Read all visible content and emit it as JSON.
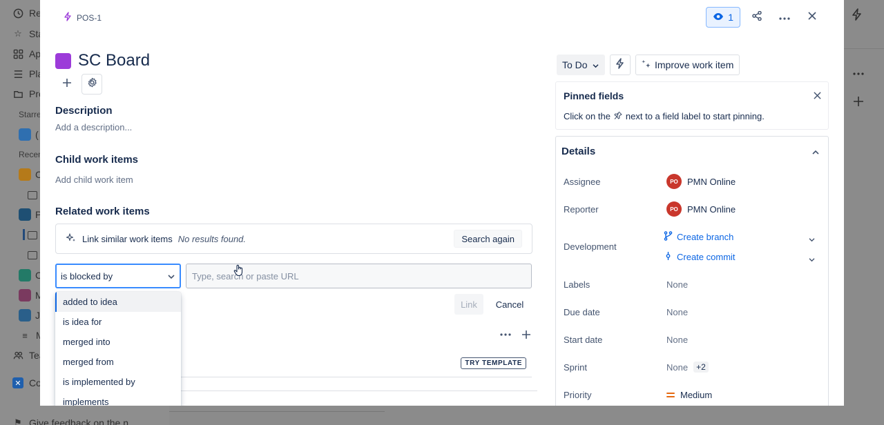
{
  "background": {
    "sidebar_items": [
      {
        "label": "Rec",
        "icon": "clock-icon"
      },
      {
        "label": "Sta",
        "icon": "star-icon"
      },
      {
        "label": "Ap",
        "icon": "apps-icon"
      },
      {
        "label": "Pla",
        "icon": "plans-icon"
      },
      {
        "label": "Pro",
        "icon": "projects-icon"
      }
    ],
    "sidebar_sections": [
      "Starre",
      "Recen"
    ],
    "sidebar_projects": [
      "(",
      "C",
      "P",
      "C",
      "M",
      "J",
      "M"
    ],
    "sidebar_bottom": [
      "Tea",
      "Co",
      "Give feedback on the n"
    ]
  },
  "modal": {
    "issue_key": "POS-1",
    "watch_count": "1",
    "title": "SC Board",
    "title_color": "#9c3bd9",
    "description": {
      "heading": "Description",
      "placeholder": "Add a description..."
    },
    "child_items": {
      "heading": "Child work items",
      "placeholder": "Add child work item"
    },
    "related": {
      "heading": "Related work items",
      "link_similar_label": "Link similar work items",
      "no_results": "No results found.",
      "search_again": "Search again",
      "link_type_selected": "is blocked by",
      "url_placeholder": "Type, search or paste URL",
      "link_button": "Link",
      "cancel_button": "Cancel",
      "link_type_options": [
        "added to idea",
        "is idea for",
        "merged into",
        "merged from",
        "is implemented by",
        "implements"
      ]
    },
    "try_template": "TRY TEMPLATE",
    "status": "To Do",
    "improve_label": "Improve work item",
    "pinned": {
      "title": "Pinned fields",
      "text_before": "Click on the",
      "text_after": "next to a field label to start pinning."
    },
    "details": {
      "heading": "Details",
      "assignee_label": "Assignee",
      "assignee_initials": "PO",
      "assignee_value": "PMN Online",
      "reporter_label": "Reporter",
      "reporter_initials": "PO",
      "reporter_value": "PMN Online",
      "development_label": "Development",
      "create_branch": "Create branch",
      "create_commit": "Create commit",
      "labels_label": "Labels",
      "labels_value": "None",
      "due_date_label": "Due date",
      "due_date_value": "None",
      "start_date_label": "Start date",
      "start_date_value": "None",
      "sprint_label": "Sprint",
      "sprint_value": "None",
      "sprint_extra": "+2",
      "priority_label": "Priority",
      "priority_value": "Medium",
      "priority_color": "#e56910"
    }
  }
}
